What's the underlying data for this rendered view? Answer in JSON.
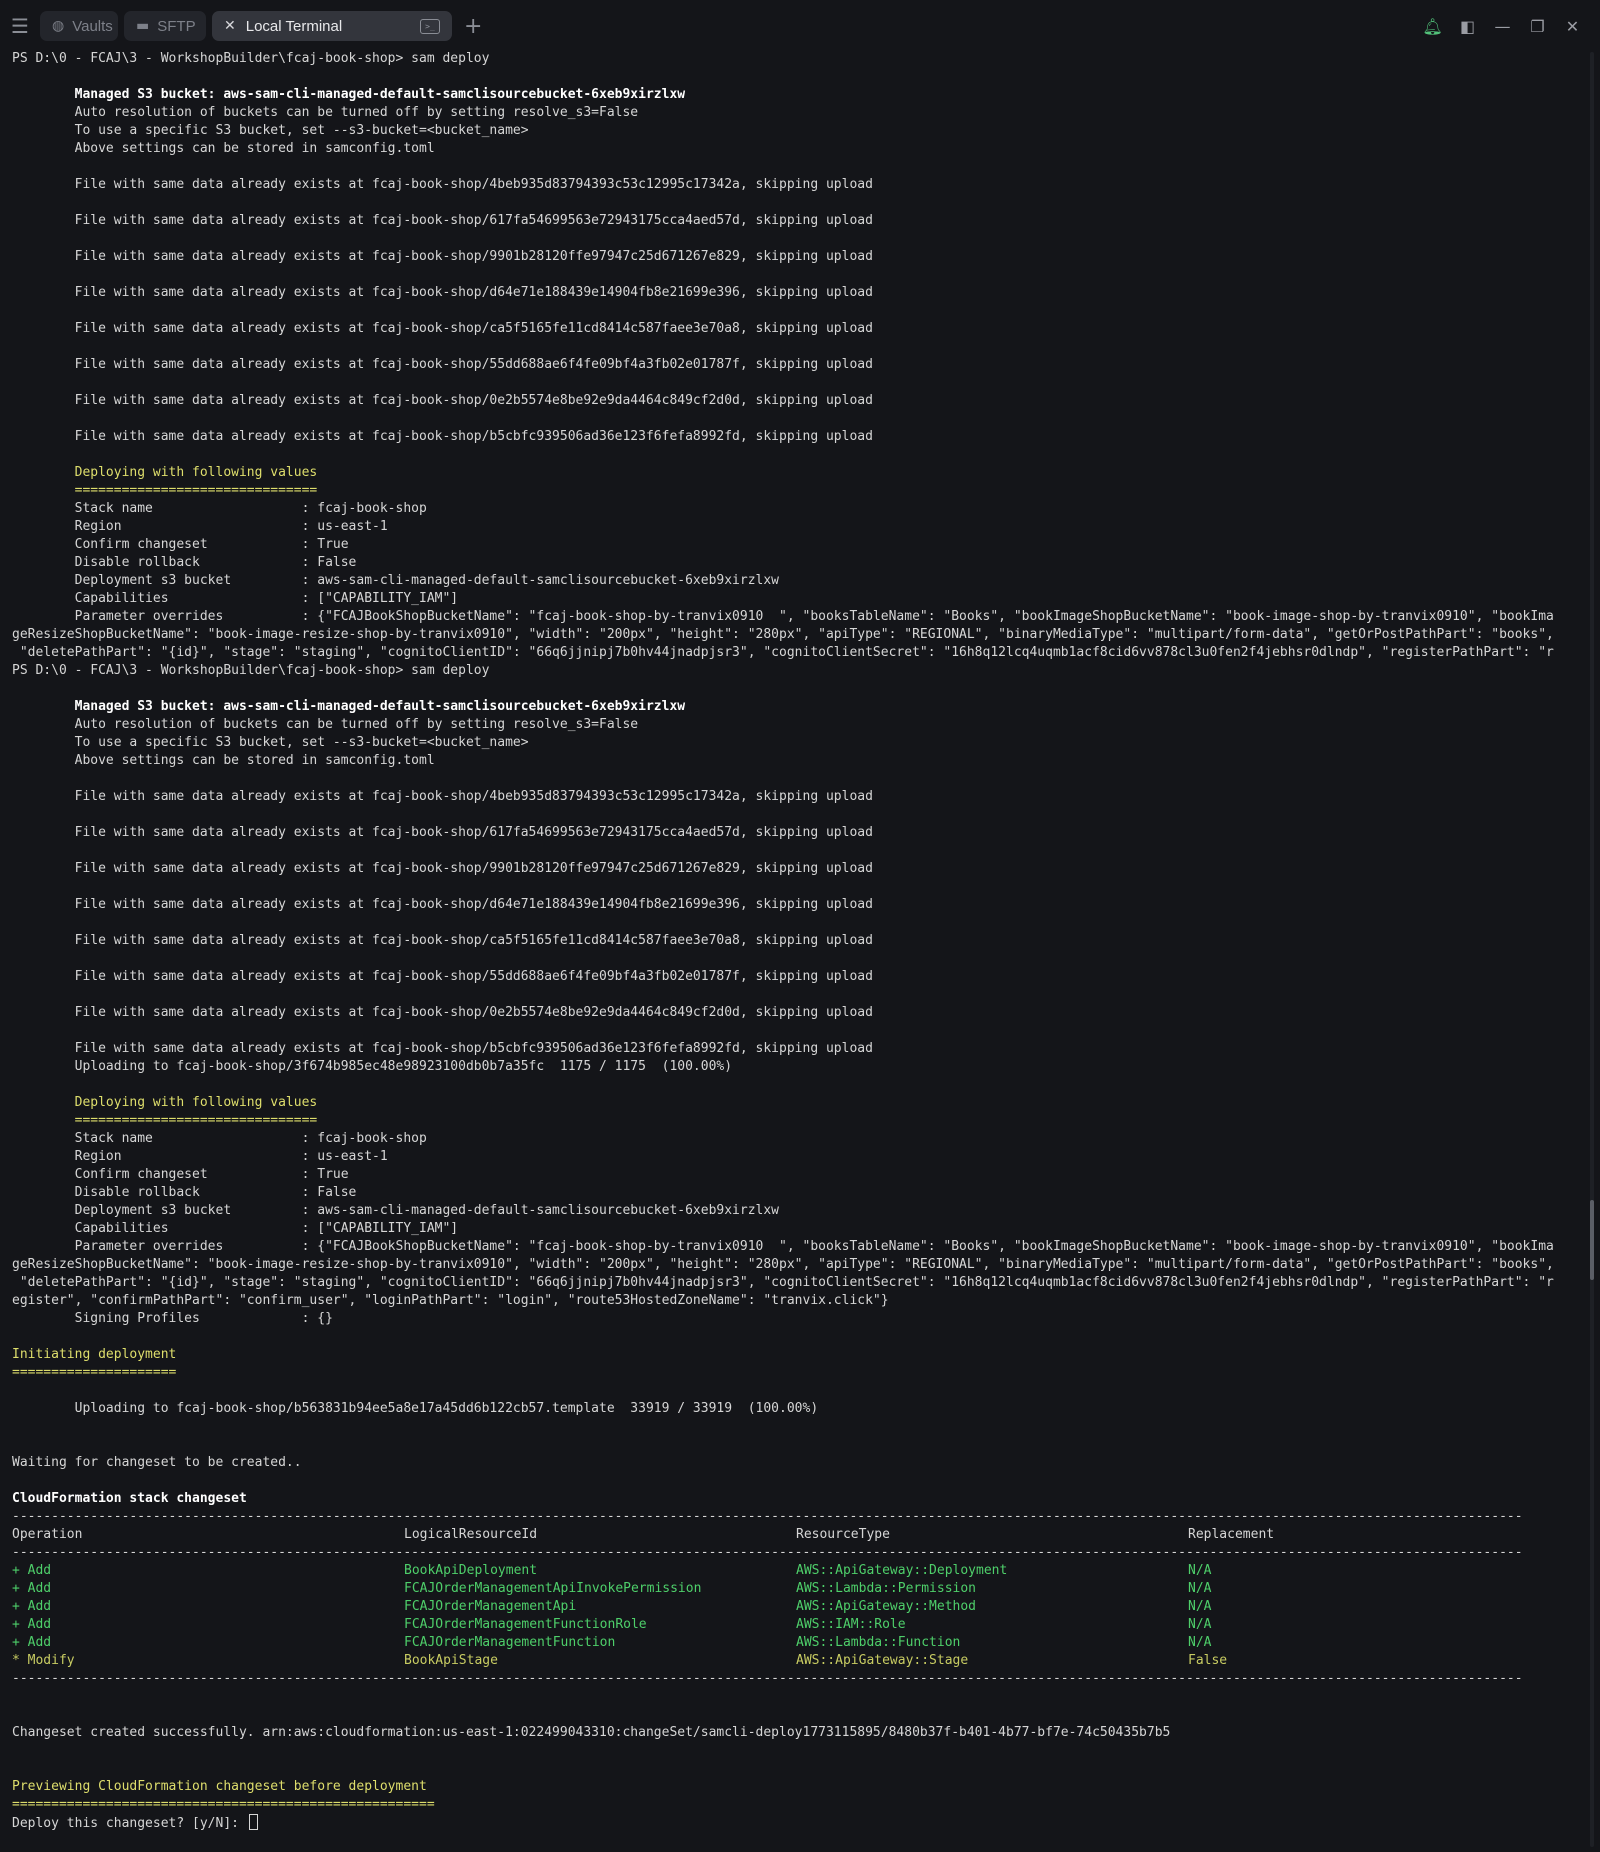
{
  "tabs": {
    "vaults": "Vaults",
    "sftp": "SFTP",
    "active": "Local Terminal"
  },
  "icons": {
    "menu": "hamburger-icon",
    "vault": "vault-icon",
    "folder": "folder-icon",
    "close": "close-icon",
    "terminal": "terminal-icon",
    "add": "plus-icon",
    "bell": "bell-icon",
    "panel": "sidebar-panel-icon",
    "minimize": "minimize-icon",
    "restore": "restore-icon",
    "window_close": "window-close-icon"
  },
  "terminal": {
    "lines": [
      {
        "t": "PS D:\\0 - FCAJ\\3 - WorkshopBuilder\\fcaj-book-shop> sam deploy",
        "c": ""
      },
      {
        "t": "",
        "c": ""
      },
      {
        "t": "        Managed S3 bucket: aws-sam-cli-managed-default-samclisourcebucket-6xeb9xirzlxw",
        "c": "b"
      },
      {
        "t": "        Auto resolution of buckets can be turned off by setting resolve_s3=False",
        "c": ""
      },
      {
        "t": "        To use a specific S3 bucket, set --s3-bucket=<bucket_name>",
        "c": ""
      },
      {
        "t": "        Above settings can be stored in samconfig.toml",
        "c": ""
      },
      {
        "t": "",
        "c": ""
      },
      {
        "t": "        File with same data already exists at fcaj-book-shop/4beb935d83794393c53c12995c17342a, skipping upload",
        "c": ""
      },
      {
        "t": "",
        "c": ""
      },
      {
        "t": "        File with same data already exists at fcaj-book-shop/617fa54699563e72943175cca4aed57d, skipping upload",
        "c": ""
      },
      {
        "t": "",
        "c": ""
      },
      {
        "t": "        File with same data already exists at fcaj-book-shop/9901b28120ffe97947c25d671267e829, skipping upload",
        "c": ""
      },
      {
        "t": "",
        "c": ""
      },
      {
        "t": "        File with same data already exists at fcaj-book-shop/d64e71e188439e14904fb8e21699e396, skipping upload",
        "c": ""
      },
      {
        "t": "",
        "c": ""
      },
      {
        "t": "        File with same data already exists at fcaj-book-shop/ca5f5165fe11cd8414c587faee3e70a8, skipping upload",
        "c": ""
      },
      {
        "t": "",
        "c": ""
      },
      {
        "t": "        File with same data already exists at fcaj-book-shop/55dd688ae6f4fe09bf4a3fb02e01787f, skipping upload",
        "c": ""
      },
      {
        "t": "",
        "c": ""
      },
      {
        "t": "        File with same data already exists at fcaj-book-shop/0e2b5574e8be92e9da4464c849cf2d0d, skipping upload",
        "c": ""
      },
      {
        "t": "",
        "c": ""
      },
      {
        "t": "        File with same data already exists at fcaj-book-shop/b5cbfc939506ad36e123f6fefa8992fd, skipping upload",
        "c": ""
      },
      {
        "t": "",
        "c": ""
      },
      {
        "t": "        Deploying with following values",
        "c": "y"
      },
      {
        "t": "        ===============================",
        "c": "y"
      },
      {
        "t": "        Stack name                   : fcaj-book-shop",
        "c": ""
      },
      {
        "t": "        Region                       : us-east-1",
        "c": ""
      },
      {
        "t": "        Confirm changeset            : True",
        "c": ""
      },
      {
        "t": "        Disable rollback             : False",
        "c": ""
      },
      {
        "t": "        Deployment s3 bucket         : aws-sam-cli-managed-default-samclisourcebucket-6xeb9xirzlxw",
        "c": ""
      },
      {
        "t": "        Capabilities                 : [\"CAPABILITY_IAM\"]",
        "c": ""
      },
      {
        "t": "        Parameter overrides          : {\"FCAJBookShopBucketName\": \"fcaj-book-shop-by-tranvix0910  \", \"booksTableName\": \"Books\", \"bookImageShopBucketName\": \"book-image-shop-by-tranvix0910\", \"bookIma",
        "c": ""
      },
      {
        "t": "geResizeShopBucketName\": \"book-image-resize-shop-by-tranvix0910\", \"width\": \"200px\", \"height\": \"280px\", \"apiType\": \"REGIONAL\", \"binaryMediaType\": \"multipart/form-data\", \"getOrPostPathPart\": \"books\",",
        "c": ""
      },
      {
        "t": " \"deletePathPart\": \"{id}\", \"stage\": \"staging\", \"cognitoClientID\": \"66q6jjnipj7b0hv44jnadpjsr3\", \"cognitoClientSecret\": \"16h8q12lcq4uqmb1acf8cid6vv878cl3u0fen2f4jebhsr0dlndp\", \"registerPathPart\": \"r",
        "c": ""
      },
      {
        "t": "PS D:\\0 - FCAJ\\3 - WorkshopBuilder\\fcaj-book-shop> sam deploy",
        "c": ""
      },
      {
        "t": "",
        "c": ""
      },
      {
        "t": "        Managed S3 bucket: aws-sam-cli-managed-default-samclisourcebucket-6xeb9xirzlxw",
        "c": "b"
      },
      {
        "t": "        Auto resolution of buckets can be turned off by setting resolve_s3=False",
        "c": ""
      },
      {
        "t": "        To use a specific S3 bucket, set --s3-bucket=<bucket_name>",
        "c": ""
      },
      {
        "t": "        Above settings can be stored in samconfig.toml",
        "c": ""
      },
      {
        "t": "",
        "c": ""
      },
      {
        "t": "        File with same data already exists at fcaj-book-shop/4beb935d83794393c53c12995c17342a, skipping upload",
        "c": ""
      },
      {
        "t": "",
        "c": ""
      },
      {
        "t": "        File with same data already exists at fcaj-book-shop/617fa54699563e72943175cca4aed57d, skipping upload",
        "c": ""
      },
      {
        "t": "",
        "c": ""
      },
      {
        "t": "        File with same data already exists at fcaj-book-shop/9901b28120ffe97947c25d671267e829, skipping upload",
        "c": ""
      },
      {
        "t": "",
        "c": ""
      },
      {
        "t": "        File with same data already exists at fcaj-book-shop/d64e71e188439e14904fb8e21699e396, skipping upload",
        "c": ""
      },
      {
        "t": "",
        "c": ""
      },
      {
        "t": "        File with same data already exists at fcaj-book-shop/ca5f5165fe11cd8414c587faee3e70a8, skipping upload",
        "c": ""
      },
      {
        "t": "",
        "c": ""
      },
      {
        "t": "        File with same data already exists at fcaj-book-shop/55dd688ae6f4fe09bf4a3fb02e01787f, skipping upload",
        "c": ""
      },
      {
        "t": "",
        "c": ""
      },
      {
        "t": "        File with same data already exists at fcaj-book-shop/0e2b5574e8be92e9da4464c849cf2d0d, skipping upload",
        "c": ""
      },
      {
        "t": "",
        "c": ""
      },
      {
        "t": "        File with same data already exists at fcaj-book-shop/b5cbfc939506ad36e123f6fefa8992fd, skipping upload",
        "c": ""
      },
      {
        "t": "        Uploading to fcaj-book-shop/3f674b985ec48e98923100db0b7a35fc  1175 / 1175  (100.00%)",
        "c": ""
      },
      {
        "t": "",
        "c": ""
      },
      {
        "t": "        Deploying with following values",
        "c": "y"
      },
      {
        "t": "        ===============================",
        "c": "y"
      },
      {
        "t": "        Stack name                   : fcaj-book-shop",
        "c": ""
      },
      {
        "t": "        Region                       : us-east-1",
        "c": ""
      },
      {
        "t": "        Confirm changeset            : True",
        "c": ""
      },
      {
        "t": "        Disable rollback             : False",
        "c": ""
      },
      {
        "t": "        Deployment s3 bucket         : aws-sam-cli-managed-default-samclisourcebucket-6xeb9xirzlxw",
        "c": ""
      },
      {
        "t": "        Capabilities                 : [\"CAPABILITY_IAM\"]",
        "c": ""
      },
      {
        "t": "        Parameter overrides          : {\"FCAJBookShopBucketName\": \"fcaj-book-shop-by-tranvix0910  \", \"booksTableName\": \"Books\", \"bookImageShopBucketName\": \"book-image-shop-by-tranvix0910\", \"bookIma",
        "c": ""
      },
      {
        "t": "geResizeShopBucketName\": \"book-image-resize-shop-by-tranvix0910\", \"width\": \"200px\", \"height\": \"280px\", \"apiType\": \"REGIONAL\", \"binaryMediaType\": \"multipart/form-data\", \"getOrPostPathPart\": \"books\",",
        "c": ""
      },
      {
        "t": " \"deletePathPart\": \"{id}\", \"stage\": \"staging\", \"cognitoClientID\": \"66q6jjnipj7b0hv44jnadpjsr3\", \"cognitoClientSecret\": \"16h8q12lcq4uqmb1acf8cid6vv878cl3u0fen2f4jebhsr0dlndp\", \"registerPathPart\": \"r",
        "c": ""
      },
      {
        "t": "egister\", \"confirmPathPart\": \"confirm_user\", \"loginPathPart\": \"login\", \"route53HostedZoneName\": \"tranvix.click\"}",
        "c": ""
      },
      {
        "t": "        Signing Profiles             : {}",
        "c": ""
      },
      {
        "t": "",
        "c": ""
      },
      {
        "t": "Initiating deployment",
        "c": "y"
      },
      {
        "t": "=====================",
        "c": "y"
      },
      {
        "t": "",
        "c": ""
      },
      {
        "t": "        Uploading to fcaj-book-shop/b563831b94ee5a8e17a45dd6b122cb57.template  33919 / 33919  (100.00%)",
        "c": ""
      },
      {
        "t": "",
        "c": ""
      },
      {
        "t": "",
        "c": ""
      },
      {
        "t": "Waiting for changeset to be created..",
        "c": ""
      },
      {
        "t": "",
        "c": ""
      },
      {
        "t": "CloudFormation stack changeset",
        "c": "b"
      }
    ],
    "changeset": {
      "rule": "-------------------------------------------------------------------------------------------------------------------------------------------------------------------------------------------------",
      "headers": [
        "Operation",
        "LogicalResourceId",
        "ResourceType",
        "Replacement"
      ],
      "rows": [
        {
          "op": "+ Add",
          "id": "BookApiDeployment",
          "type": "AWS::ApiGateway::Deployment",
          "rep": "N/A",
          "c": "g"
        },
        {
          "op": "+ Add",
          "id": "FCAJOrderManagementApiInvokePermission",
          "type": "AWS::Lambda::Permission",
          "rep": "N/A",
          "c": "g"
        },
        {
          "op": "+ Add",
          "id": "FCAJOrderManagementApi",
          "type": "AWS::ApiGateway::Method",
          "rep": "N/A",
          "c": "g"
        },
        {
          "op": "+ Add",
          "id": "FCAJOrderManagementFunctionRole",
          "type": "AWS::IAM::Role",
          "rep": "N/A",
          "c": "g"
        },
        {
          "op": "+ Add",
          "id": "FCAJOrderManagementFunction",
          "type": "AWS::Lambda::Function",
          "rep": "N/A",
          "c": "g"
        },
        {
          "op": "* Modify",
          "id": "BookApiStage",
          "type": "AWS::ApiGateway::Stage",
          "rep": "False",
          "c": "yg"
        }
      ]
    },
    "after": [
      {
        "t": "",
        "c": ""
      },
      {
        "t": "",
        "c": ""
      },
      {
        "t": "Changeset created successfully. arn:aws:cloudformation:us-east-1:022499043310:changeSet/samcli-deploy1773115895/8480b37f-b401-4b77-bf7e-74c50435b7b5",
        "c": ""
      },
      {
        "t": "",
        "c": ""
      },
      {
        "t": "",
        "c": ""
      },
      {
        "t": "Previewing CloudFormation changeset before deployment",
        "c": "y"
      },
      {
        "t": "======================================================",
        "c": "y"
      }
    ],
    "prompt": "Deploy this changeset? [y/N]: "
  }
}
